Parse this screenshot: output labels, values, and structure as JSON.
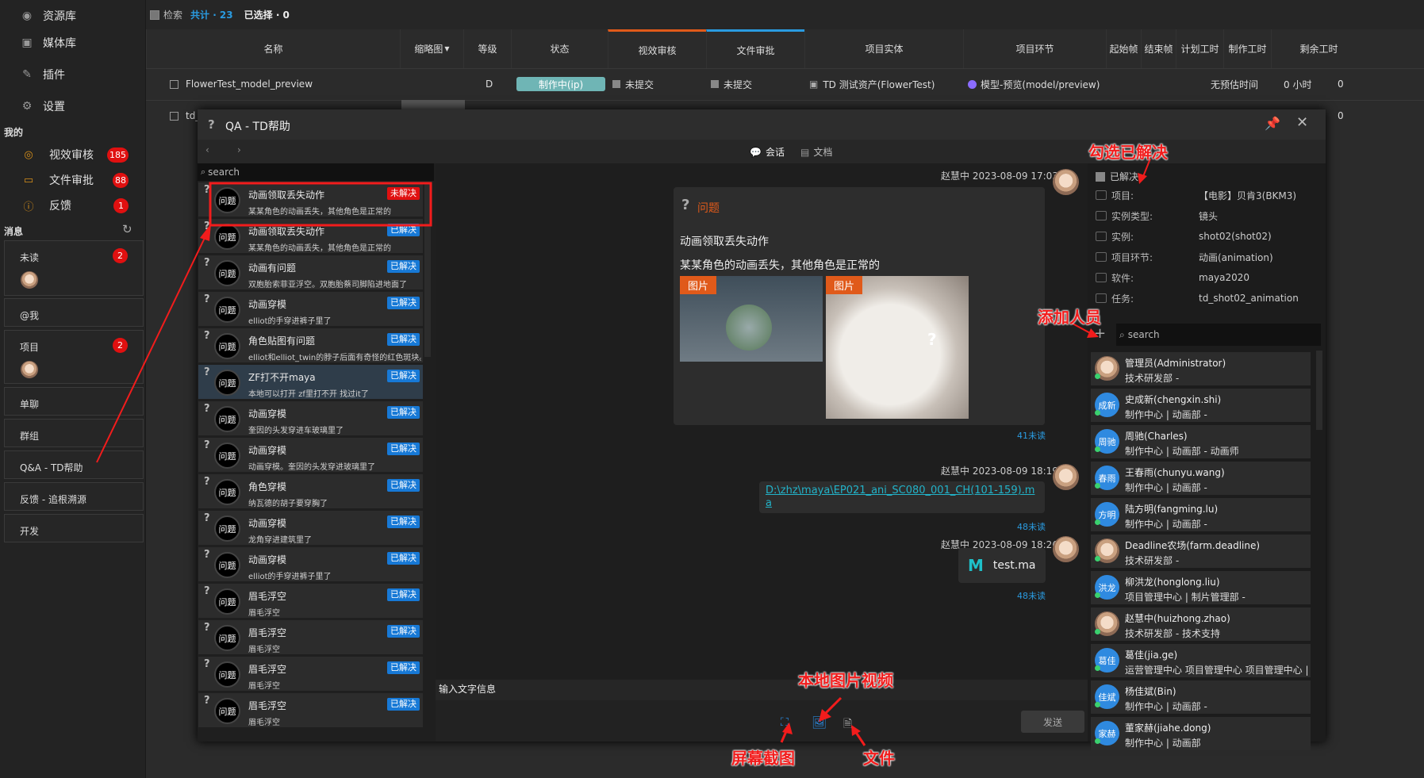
{
  "sidebar": {
    "nav": [
      {
        "label": "资源库",
        "icon": "resource-icon"
      },
      {
        "label": "媒体库",
        "icon": "media-icon"
      },
      {
        "label": "插件",
        "icon": "plugin-icon"
      },
      {
        "label": "设置",
        "icon": "gear-icon"
      }
    ],
    "my_title": "我的",
    "my": [
      {
        "label": "视效审核",
        "count": "185",
        "icon": "eye-icon"
      },
      {
        "label": "文件审批",
        "count": "88",
        "icon": "folder-icon"
      },
      {
        "label": "反馈",
        "count": "1",
        "icon": "info-icon"
      }
    ],
    "msg_title": "消息",
    "msgs": [
      {
        "label": "未读",
        "count": "2"
      },
      {
        "label": "@我"
      },
      {
        "label": "项目",
        "count": "2"
      },
      {
        "label": "单聊"
      },
      {
        "label": "群组"
      },
      {
        "label": "Q&A - TD帮助"
      },
      {
        "label": "反馈 - 追根溯源"
      },
      {
        "label": "开发"
      }
    ]
  },
  "table": {
    "search_label": "检索",
    "total": "共计 · 23",
    "selected": "已选择 · 0",
    "headers": [
      "名称",
      "缩略图",
      "等级",
      "状态",
      "视效审核",
      "文件审批",
      "项目实体",
      "项目环节",
      "起始帧",
      "结束帧",
      "计划工时",
      "制作工时",
      "剩余工时"
    ],
    "rows": [
      {
        "name": "FlowerTest_model_preview",
        "level": "D",
        "status": "制作中(ip)",
        "vfx": "未提交",
        "file": "未提交",
        "entity": "TD 测试资产(FlowerTest)",
        "step": "模型-预览(model/preview)",
        "plan": "无预估时间",
        "made": "0 小时",
        "remain": "0"
      },
      {
        "name": "td_",
        "remain": "0"
      }
    ]
  },
  "dialog": {
    "title": "QA - TD帮助",
    "tab_chat": "会话",
    "tab_docs": "文档",
    "search_placeholder": "search",
    "questions": [
      {
        "avatar": "问题",
        "title": "动画领取丢失动作",
        "sub": "某某角色的动画丢失，其他角色是正常的",
        "tag": "未解决"
      },
      {
        "avatar": "问题",
        "title": "动画领取丢失动作",
        "sub": "某某角色的动画丢失，其他角色是正常的",
        "tag": "已解决"
      },
      {
        "avatar": "问题",
        "title": "动画有问题",
        "sub": "双胞胎索菲亚浮空。双胞胎蔡司脚陷进地面了",
        "tag": "已解决"
      },
      {
        "avatar": "问题",
        "title": "动画穿模",
        "sub": "elliot的手穿进裤子里了",
        "tag": "已解决"
      },
      {
        "avatar": "问题",
        "title": "角色贴图有问题",
        "sub": "elliot和elliot_twin的脖子后面有奇怪的红色斑块。...",
        "tag": "已解决"
      },
      {
        "avatar": "问题",
        "title": "ZF打不开maya",
        "sub": "本地可以打开 zf里打不开 找过it了",
        "tag": "已解决"
      },
      {
        "avatar": "问题",
        "title": "动画穿模",
        "sub": "奎因的头发穿进车玻璃里了",
        "tag": "已解决"
      },
      {
        "avatar": "问题",
        "title": "动画穿模",
        "sub": "动画穿模。奎因的头发穿进玻璃里了",
        "tag": "已解决"
      },
      {
        "avatar": "问题",
        "title": "角色穿模",
        "sub": "纳瓦德的胡子要穿胸了",
        "tag": "已解决"
      },
      {
        "avatar": "问题",
        "title": "动画穿模",
        "sub": "龙角穿进建筑里了",
        "tag": "已解决"
      },
      {
        "avatar": "问题",
        "title": "动画穿模",
        "sub": "elliot的手穿进裤子里了",
        "tag": "已解决"
      },
      {
        "avatar": "问题",
        "title": "眉毛浮空",
        "sub": "眉毛浮空",
        "tag": "已解决"
      },
      {
        "avatar": "问题",
        "title": "眉毛浮空",
        "sub": "眉毛浮空",
        "tag": "已解决"
      },
      {
        "avatar": "问题",
        "title": "眉毛浮空",
        "sub": "眉毛浮空",
        "tag": "已解决"
      },
      {
        "avatar": "问题",
        "title": "眉毛浮空",
        "sub": "眉毛浮空",
        "tag": "已解决"
      }
    ],
    "messages": [
      {
        "sender": "赵慧中 2023-08-09 17:03:03",
        "card_title": "问题",
        "q_title": "动画领取丢失动作",
        "q_body": "某某角色的动画丢失，其他角色是正常的",
        "img_label": "图片",
        "read": "41未读"
      },
      {
        "sender": "赵慧中 2023-08-09 18:19:52",
        "path": "D:\\zhz\\maya\\EP021_ani_SC080_001_CH(101-159).ma",
        "read": "48未读"
      },
      {
        "sender": "赵慧中 2023-08-09 18:26:07",
        "file": "test.ma",
        "read": "48未读"
      }
    ],
    "input_label": "输入文字信息",
    "send": "发送",
    "resolved_label": "已解决",
    "meta": [
      {
        "k": "项目:",
        "v": "【电影】贝肯3(BKM3)"
      },
      {
        "k": "实例类型:",
        "v": "镜头"
      },
      {
        "k": "实例:",
        "v": "shot02(shot02)"
      },
      {
        "k": "项目环节:",
        "v": "动画(animation)"
      },
      {
        "k": "软件:",
        "v": "maya2020"
      },
      {
        "k": "任务:",
        "v": "td_shot02_animation"
      }
    ],
    "people_search": "search",
    "people": [
      {
        "avatar": "",
        "name": "管理员(Administrator)",
        "dept": "技术研发部 -"
      },
      {
        "avatar": "成新",
        "name": "史成新(chengxin.shi)",
        "dept": "制作中心 | 动画部 -"
      },
      {
        "avatar": "周驰",
        "name": "周驰(Charles)",
        "dept": "制作中心 | 动画部 - 动画师"
      },
      {
        "avatar": "春雨",
        "name": "王春雨(chunyu.wang)",
        "dept": "制作中心 | 动画部 -"
      },
      {
        "avatar": "方明",
        "name": "陆方明(fangming.lu)",
        "dept": "制作中心 | 动画部 -"
      },
      {
        "avatar": "",
        "name": "Deadline农场(farm.deadline)",
        "dept": "技术研发部 -"
      },
      {
        "avatar": "洪龙",
        "name": "柳洪龙(honglong.liu)",
        "dept": "项目管理中心 | 制片管理部 -"
      },
      {
        "avatar": "",
        "name": "赵慧中(huizhong.zhao)",
        "dept": "技术研发部 - 技术支持"
      },
      {
        "avatar": "葛佳",
        "name": "葛佳(jia.ge)",
        "dept": "运营管理中心 项目管理中心 项目管理中心 | 制"
      },
      {
        "avatar": "佳斌",
        "name": "杨佳斌(Bin)",
        "dept": "制作中心 | 动画部 -"
      },
      {
        "avatar": "家赫",
        "name": "董家赫(jiahe.dong)",
        "dept": "制作中心 | 动画部"
      }
    ]
  },
  "annotations": {
    "resolved": "勾选已解决",
    "add_people": "添加人员",
    "local_media": "本地图片视频",
    "screenshot": "屏幕截图",
    "file": "文件"
  },
  "colors": {
    "accent_orange": "#e05a1a",
    "tag_blue": "#1779d6",
    "tag_red": "#e01010",
    "status_teal": "#6fb5b5",
    "link": "#22b3c9"
  }
}
